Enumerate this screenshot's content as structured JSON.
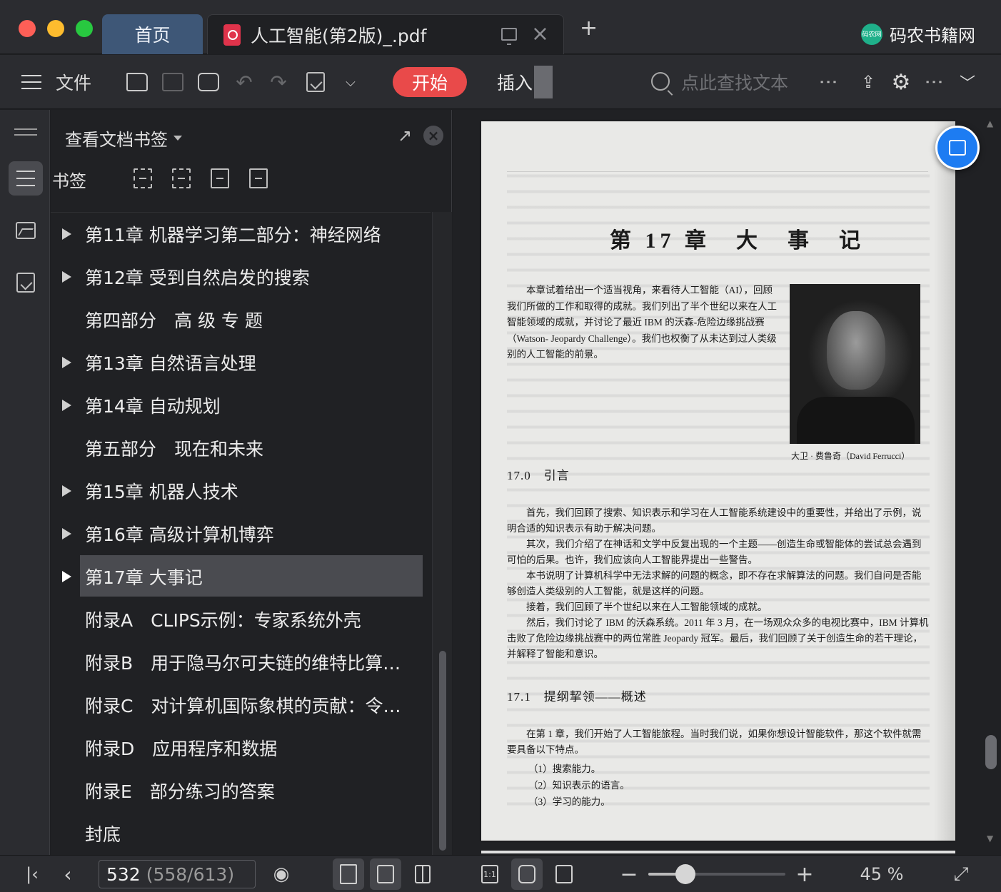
{
  "window": {
    "home_tab": "首页",
    "doc_tab": "人工智能(第2版)_.pdf",
    "brand": "码农书籍网",
    "brand_logo_text": "码农网"
  },
  "toolbar": {
    "file_label": "文件",
    "start_label": "开始",
    "insert_label": "插入",
    "search_placeholder": "点此查找文本"
  },
  "panel": {
    "title": "查看文档书签",
    "subtitle": "书签",
    "bookmarks": [
      {
        "label": "第11章 机器学习第二部分：神经网络",
        "expandable": true,
        "selected": false
      },
      {
        "label": "第12章 受到自然启发的搜索",
        "expandable": true,
        "selected": false
      },
      {
        "label": "第四部分　高 级 专 题",
        "expandable": false,
        "selected": false
      },
      {
        "label": "第13章 自然语言处理",
        "expandable": true,
        "selected": false
      },
      {
        "label": "第14章 自动规划",
        "expandable": true,
        "selected": false
      },
      {
        "label": "第五部分　现在和未来",
        "expandable": false,
        "selected": false
      },
      {
        "label": "第15章 机器人技术",
        "expandable": true,
        "selected": false
      },
      {
        "label": "第16章 高级计算机博弈",
        "expandable": true,
        "selected": false
      },
      {
        "label": "第17章 大事记",
        "expandable": true,
        "selected": true
      },
      {
        "label": "附录A　CLIPS示例：专家系统外壳",
        "expandable": false,
        "selected": false
      },
      {
        "label": "附录B　用于隐马尔可夫链的维特比算…",
        "expandable": false,
        "selected": false
      },
      {
        "label": "附录C　对计算机国际象棋的贡献：令…",
        "expandable": false,
        "selected": false
      },
      {
        "label": "附录D　应用程序和数据",
        "expandable": false,
        "selected": false
      },
      {
        "label": "附录E　部分练习的答案",
        "expandable": false,
        "selected": false
      },
      {
        "label": "封底",
        "expandable": false,
        "selected": false
      }
    ]
  },
  "document": {
    "chapter_title": "第 17 章　大　事　记",
    "intro": "本章试着给出一个适当视角，来看待人工智能（AI），回顾我们所做的工作和取得的成就。我们列出了半个世纪以来在人工智能领域的成就，并讨论了最近 IBM 的沃森-危险边缘挑战赛（Watson- Jeopardy Challenge）。我们也权衡了从未达到过人类级别的人工智能的前景。",
    "photo_caption": "大卫 · 费鲁奇（David Ferrucci）",
    "section_0": "17.0　引言",
    "para_1": "首先，我们回顾了搜索、知识表示和学习在人工智能系统建设中的重要性，并给出了示例，说明合适的知识表示有助于解决问题。",
    "para_2": "其次，我们介绍了在神话和文学中反复出现的一个主题——创造生命或智能体的尝试总会遇到可怕的后果。也许，我们应该向人工智能界提出一些警告。",
    "para_3": "本书说明了计算机科学中无法求解的问题的概念，即不存在求解算法的问题。我们自问是否能够创造人类级别的人工智能，就是这样的问题。",
    "para_4": "接着，我们回顾了半个世纪以来在人工智能领域的成就。",
    "para_5": "然后，我们讨论了 IBM 的沃森系统。2011 年 3 月，在一场观众众多的电视比赛中，IBM 计算机击败了危险边缘挑战赛中的两位常胜 Jeopardy 冠军。最后，我们回顾了关于创造生命的若干理论，并解释了智能和意识。",
    "section_1": "17.1　提纲挈领——概述",
    "para_6": "在第 1 章，我们开始了人工智能旅程。当时我们说，如果你想设计智能软件，那这个软件就需要具备以下特点。",
    "list": [
      "（1）搜索能力。",
      "（2）知识表示的语言。",
      "（3）学习的能力。"
    ]
  },
  "status": {
    "current_page": "532",
    "page_info": "(558/613)",
    "zoom_label": "45 %",
    "zoom_fraction": 0.27
  },
  "colors": {
    "accent_start": "#e94a4a",
    "home_tab": "#3e5777",
    "float_button": "#1d7cf2"
  }
}
